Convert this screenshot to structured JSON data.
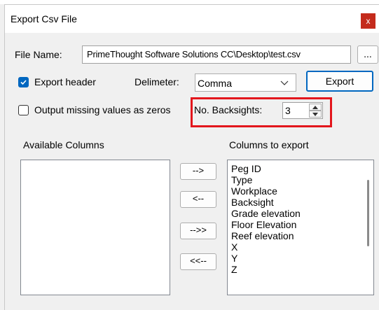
{
  "window": {
    "title": "Export Csv File",
    "close_label": "x"
  },
  "file_name": {
    "label": "File Name:",
    "value": "PrimeThought Software Solutions CC\\Desktop\\test.csv",
    "browse_label": "..."
  },
  "export_header": {
    "label": "Export header",
    "checked": true
  },
  "delimiter": {
    "label": "Delimeter:",
    "selected": "Comma"
  },
  "export_button": "Export",
  "output_missing": {
    "label": "Output missing values as zeros",
    "checked": false
  },
  "backsights": {
    "label": "No. Backsights:",
    "value": "3"
  },
  "available_columns": {
    "label": "Available Columns",
    "items": []
  },
  "columns_to_export": {
    "label": "Columns to export",
    "items": [
      "Peg ID",
      "Type",
      "Workplace",
      "Backsight",
      "Grade elevation",
      "Floor Elevation",
      "Reef elevation",
      "X",
      "Y",
      "Z"
    ]
  },
  "move_buttons": {
    "add": "-->",
    "remove": "<--",
    "add_all": "-->>",
    "remove_all": "<<--"
  },
  "colors": {
    "accent": "#0067c0",
    "close": "#c42b1c",
    "highlight": "#e3161c"
  }
}
